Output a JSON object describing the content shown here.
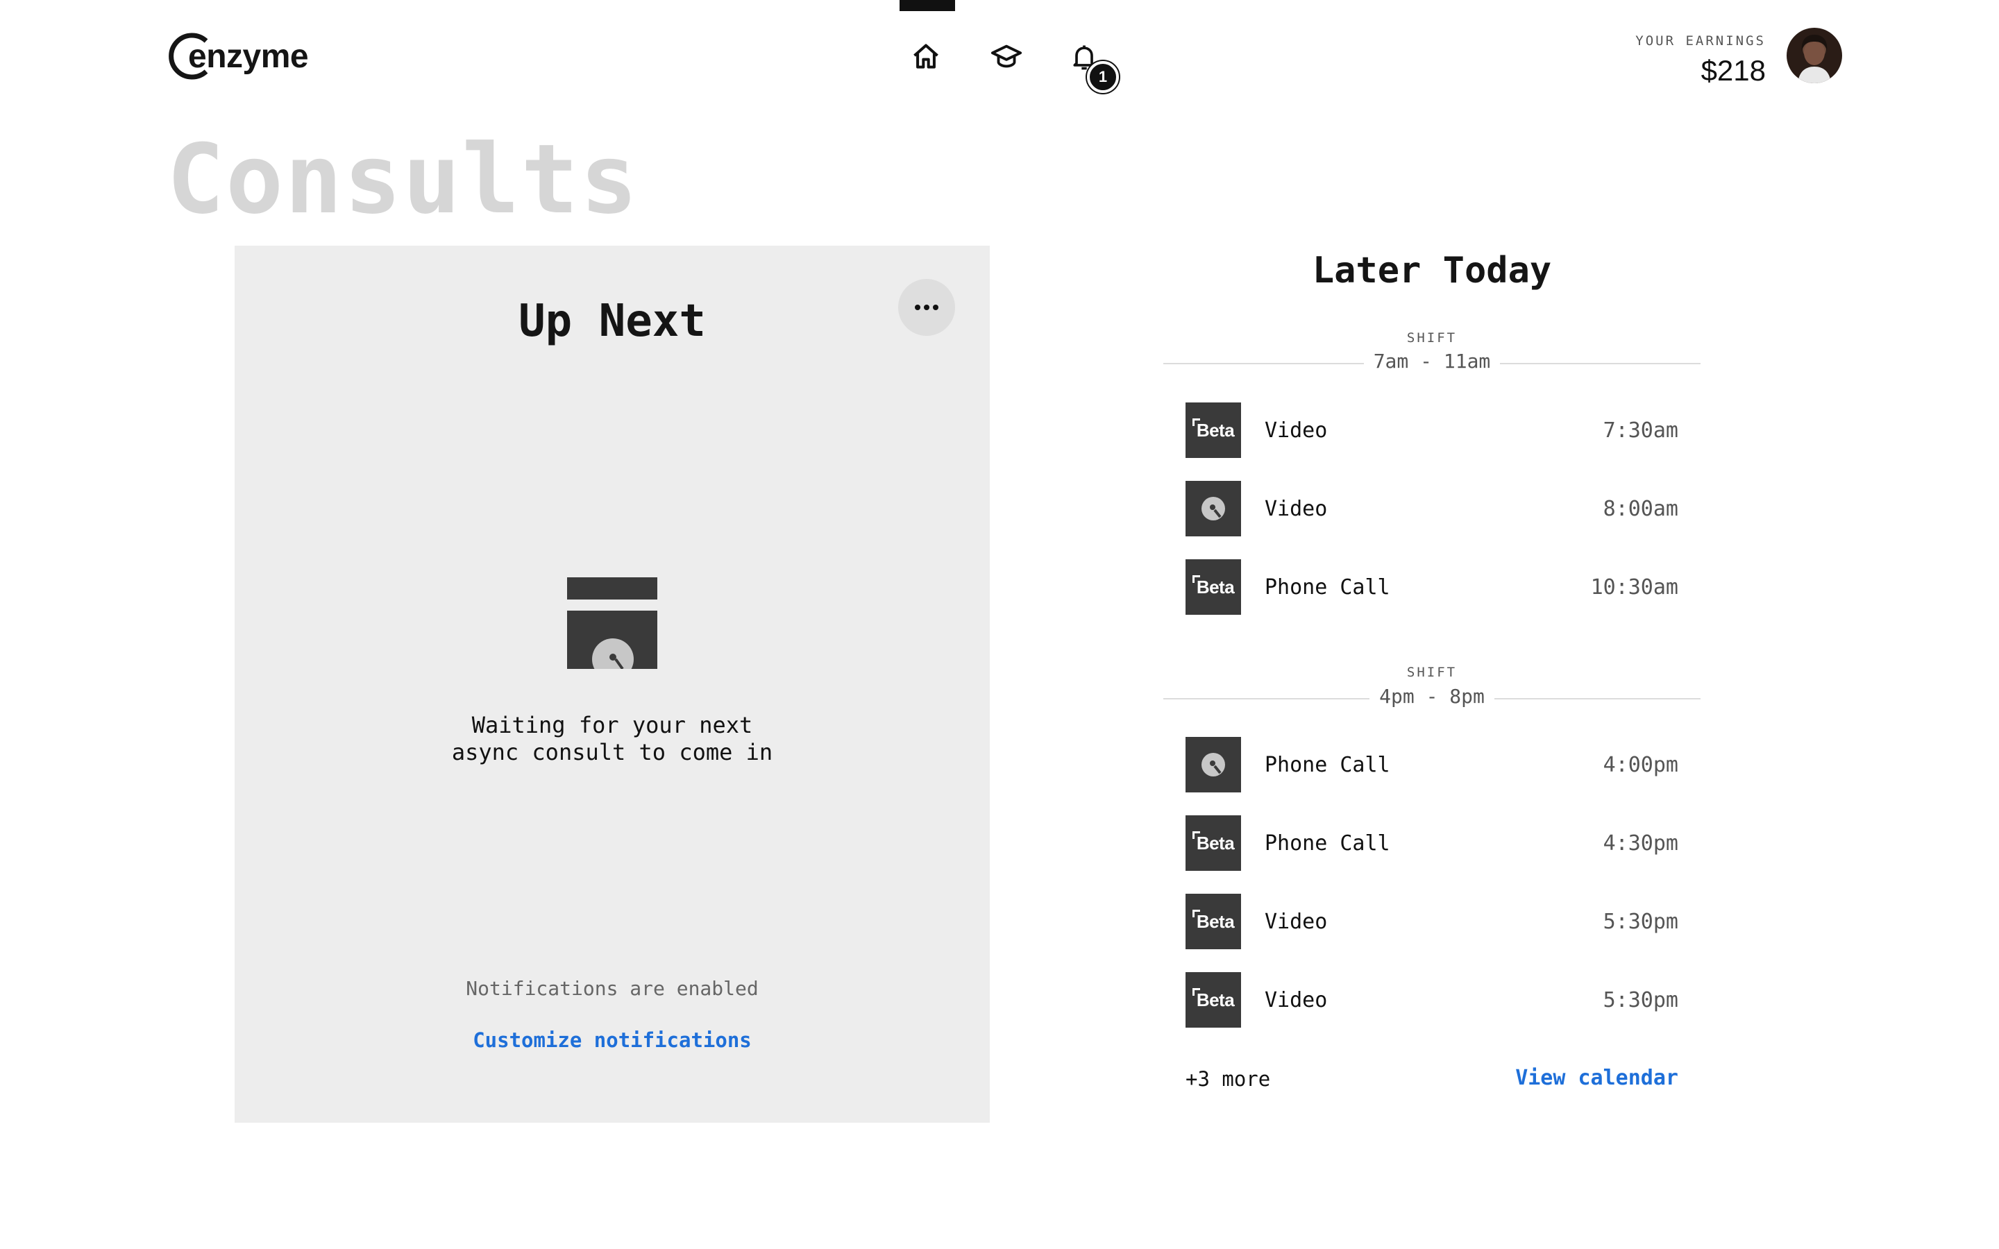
{
  "brand": {
    "name": "enzyme"
  },
  "nav": {
    "items": [
      {
        "name": "home",
        "icon": "home-icon"
      },
      {
        "name": "learn",
        "icon": "graduation-cap-icon"
      },
      {
        "name": "notifications",
        "icon": "bell-icon"
      }
    ],
    "notification_count": "1"
  },
  "earnings": {
    "label": "YOUR EARNINGS",
    "value": "$218"
  },
  "page": {
    "title": "Consults"
  },
  "up_next": {
    "title": "Up Next",
    "more_icon": "ellipsis-icon",
    "waiting_text": "Waiting for your next\nasync consult to come in",
    "notifications_status": "Notifications are enabled",
    "customize_link": "Customize notifications"
  },
  "later_today": {
    "title": "Later Today",
    "shifts": [
      {
        "label": "SHIFT",
        "range": "7am - 11am",
        "consults": [
          {
            "thumb": "beta",
            "type": "Video",
            "time": "7:30am"
          },
          {
            "thumb": "disc",
            "type": "Video",
            "time": "8:00am"
          },
          {
            "thumb": "beta",
            "type": "Phone Call",
            "time": "10:30am"
          }
        ]
      },
      {
        "label": "SHIFT",
        "range": "4pm - 8pm",
        "consults": [
          {
            "thumb": "disc",
            "type": "Phone Call",
            "time": "4:00pm"
          },
          {
            "thumb": "beta",
            "type": "Phone Call",
            "time": "4:30pm"
          },
          {
            "thumb": "beta",
            "type": "Video",
            "time": "5:30pm"
          },
          {
            "thumb": "beta",
            "type": "Video",
            "time": "5:30pm"
          }
        ]
      }
    ],
    "beta_text": "Beta",
    "more_count": "+3 more",
    "view_calendar": "View calendar"
  },
  "colors": {
    "link": "#1e6fd9",
    "thumb": "#3a3a3a",
    "card": "#ededed",
    "title_muted": "#d6d6d6"
  }
}
